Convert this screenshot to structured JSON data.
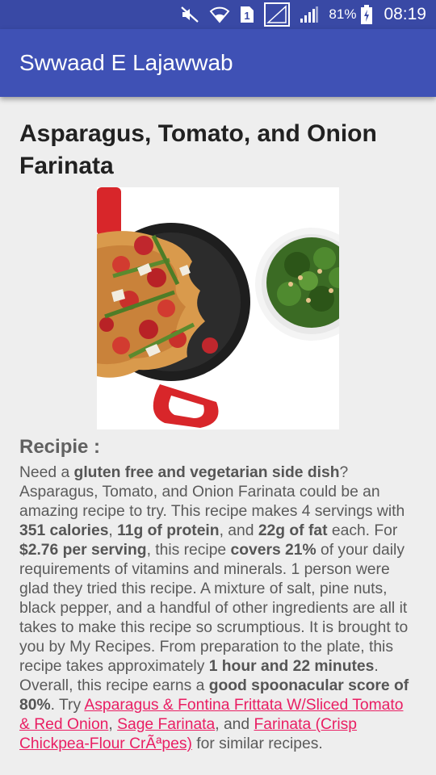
{
  "status_bar": {
    "battery_percent": "81%",
    "time": "08:19",
    "sim_slot": "1",
    "icons": [
      "mute-icon",
      "wifi-icon",
      "sim-icon",
      "no-signal-icon",
      "signal-icon",
      "battery-icon"
    ]
  },
  "app_bar": {
    "title": "Swwaad E Lajawwab"
  },
  "recipe": {
    "title": "Asparagus, Tomato, and Onion Farinata",
    "section_heading": "Recipie :",
    "summary": {
      "t1": "Need a ",
      "b1": "gluten free and vegetarian side dish",
      "t2": "? Asparagus, Tomato, and Onion Farinata could be an amazing recipe to try. This recipe makes 4 servings with ",
      "b2": "351 calories",
      "t3": ", ",
      "b3": "11g of protein",
      "t4": ", and ",
      "b4": "22g of fat",
      "t5": " each. For ",
      "b5": "$2.76 per serving",
      "t6": ", this recipe ",
      "b6": "covers 21%",
      "t7": " of your daily requirements of vitamins and minerals. 1 person were glad they tried this recipe. A mixture of salt, pine nuts, black pepper, and a handful of other ingredients are all it takes to make this recipe so scrumptious. It is brought to you by My Recipes. From preparation to the plate, this recipe takes approximately ",
      "b7": "1 hour and 22 minutes",
      "t8": ". Overall, this recipe earns a ",
      "b8": "good spoonacular score of 80%",
      "t9": ". Try ",
      "link1": "Asparagus & Fontina Frittata W/Sliced Tomato & Red Onion",
      "t10": ", ",
      "link2": "Sage Farinata",
      "t11": ", and ",
      "link3": "Farinata (Crisp Chickpea-Flour CrÃªpes)",
      "t12": " for similar recipes."
    }
  },
  "colors": {
    "status_bar": "#3949a5",
    "app_bar": "#3f51b5",
    "background": "#eeeeee",
    "link": "#e91e63"
  }
}
